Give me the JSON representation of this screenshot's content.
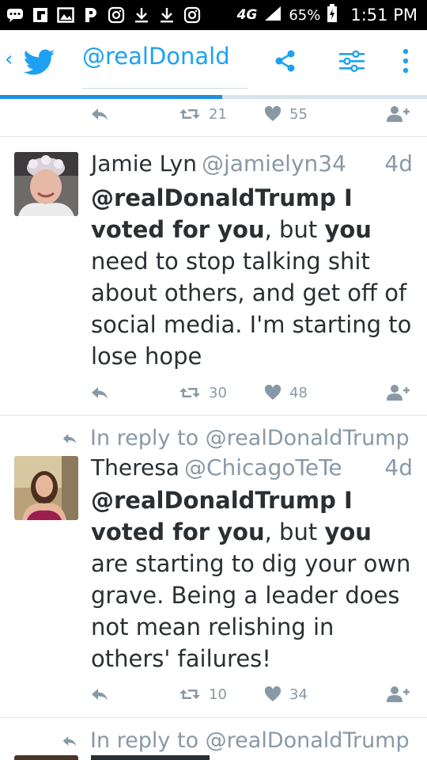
{
  "status_bar": {
    "icons": [
      "chat-icon",
      "flipboard-icon",
      "gallery-icon",
      "pandora-icon",
      "instagram-icon",
      "download-icon",
      "download-icon",
      "instagram-icon"
    ],
    "network": "4G",
    "battery": "65%",
    "time": "1:51 PM"
  },
  "header": {
    "back": "‹",
    "title": "@realDonald",
    "progress": 0.52,
    "accent": "#1da1f2"
  },
  "top_actions": {
    "retweets": "21",
    "likes": "55"
  },
  "tweets": [
    {
      "name": "Jamie Lyn",
      "handle": "@jamielyn34",
      "time": "4d",
      "reply_to": "",
      "text_parts": [
        {
          "t": "@realDonaldTrump I voted for you",
          "b": true
        },
        {
          "t": ", but ",
          "b": false
        },
        {
          "t": "you",
          "b": true
        },
        {
          "t": " need to stop talking shit about others, and get off of social media.  I'm starting to lose hope",
          "b": false
        }
      ],
      "retweets": "30",
      "likes": "48"
    },
    {
      "name": "Theresa",
      "handle": "@ChicagoTeTe",
      "time": "4d",
      "reply_to": "In reply to @realDonaldTrump",
      "text_parts": [
        {
          "t": "@realDonaldTrump I voted for you",
          "b": true
        },
        {
          "t": ", but ",
          "b": false
        },
        {
          "t": "you",
          "b": true
        },
        {
          "t": " are starting to dig your own grave. Being a leader does not mean relishing in others' failures!",
          "b": false
        }
      ],
      "retweets": "10",
      "likes": "34"
    }
  ],
  "next_reply_to": "In reply to @realDonaldTrump"
}
